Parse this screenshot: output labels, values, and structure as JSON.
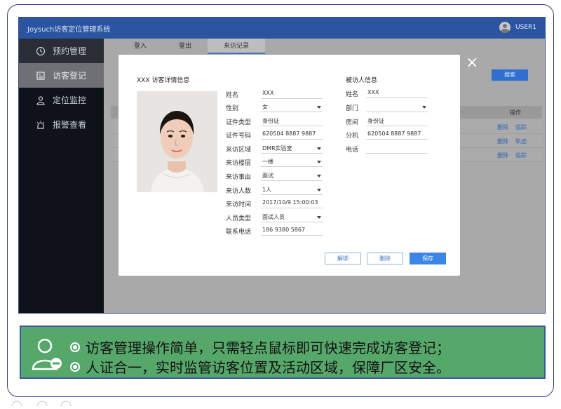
{
  "app": {
    "title": "Joysuch访客定位管理系统",
    "user": "USER1"
  },
  "sidebar": {
    "items": [
      {
        "label": "预约管理",
        "icon": "clock-icon"
      },
      {
        "label": "访客登记",
        "icon": "register-icon"
      },
      {
        "label": "定位监控",
        "icon": "location-person-icon"
      },
      {
        "label": "报警查看",
        "icon": "alarm-icon"
      }
    ],
    "active_index": 1
  },
  "tabs": [
    {
      "label": "登入"
    },
    {
      "label": "登出"
    },
    {
      "label": "来访记录"
    }
  ],
  "toolbar": {
    "search_label": "搜索"
  },
  "table": {
    "action_header": "操作",
    "rows": [
      {
        "links": [
          "删除",
          "追踪"
        ]
      },
      {
        "links": [
          "删除",
          "轨迹"
        ]
      },
      {
        "links": [
          "删除",
          "追踪"
        ]
      }
    ]
  },
  "modal": {
    "title": "XXX 访客详情信息",
    "close_label": "×",
    "visitor_fields": [
      {
        "label": "姓名",
        "value": "XXX",
        "dropdown": false
      },
      {
        "label": "性别",
        "value": "女",
        "dropdown": true
      },
      {
        "label": "证件类型",
        "value": "身份证",
        "dropdown": false
      },
      {
        "label": "证件号码",
        "value": "620504 8887 9887",
        "dropdown": false
      },
      {
        "label": "来访区域",
        "value": "DMR实验室",
        "dropdown": true
      },
      {
        "label": "来访楼层",
        "value": "一楼",
        "dropdown": true
      },
      {
        "label": "来访事由",
        "value": "面试",
        "dropdown": true
      },
      {
        "label": "来访人数",
        "value": "1人",
        "dropdown": true
      },
      {
        "label": "来访时间",
        "value": "2017/10/9 15:00:03",
        "dropdown": false
      },
      {
        "label": "人员类型",
        "value": "面试人员",
        "dropdown": true
      },
      {
        "label": "联系电话",
        "value": "186 9380 5867",
        "dropdown": false
      }
    ],
    "host_title": "被访人信息",
    "host_fields": [
      {
        "label": "姓名",
        "value": "XXX",
        "dropdown": false
      },
      {
        "label": "部门",
        "value": "",
        "dropdown": true
      },
      {
        "label": "房间",
        "value": "身份证",
        "dropdown": false
      },
      {
        "label": "分机",
        "value": "620504 8887 9887",
        "dropdown": false
      },
      {
        "label": "电话",
        "value": "",
        "dropdown": false
      }
    ],
    "buttons": {
      "release": "解绑",
      "delete": "删除",
      "save": "保存"
    }
  },
  "banner": {
    "line1": "访客管理操作简单，只需轻点鼠标即可快速完成访客登记；",
    "line2": "人证合一，实时监管访客位置及活动区域，保障厂区安全。"
  },
  "colors": {
    "topbar": "#2b55a0",
    "sidebar": "#0f1219",
    "primary": "#3c86e8",
    "banner": "#56a86a",
    "frame": "#2e3f8c"
  }
}
